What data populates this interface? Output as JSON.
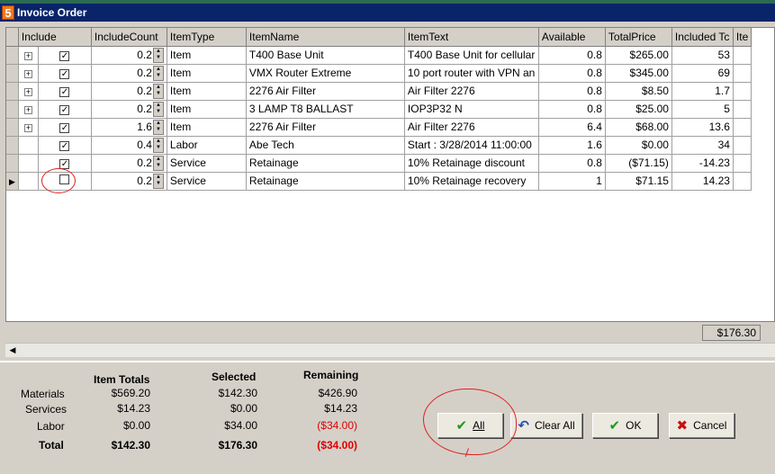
{
  "window": {
    "title": "Invoice Order",
    "app_icon_glyph": "5"
  },
  "grid": {
    "columns": [
      "Include",
      "IncludeCount",
      "ItemType",
      "ItemName",
      "ItemText",
      "Available",
      "TotalPrice",
      "Included Tc",
      "Ite"
    ],
    "rows": [
      {
        "expand": "+",
        "checked": "✓",
        "count": "0.2",
        "type": "Item",
        "name": "T400 Base Unit",
        "text": "T400 Base Unit for cellular",
        "available": "0.8",
        "total_price": "$265.00",
        "included": "53"
      },
      {
        "expand": "+",
        "checked": "✓",
        "count": "0.2",
        "type": "Item",
        "name": "VMX Router Extreme",
        "text": "10 port router with VPN an",
        "available": "0.8",
        "total_price": "$345.00",
        "included": "69"
      },
      {
        "expand": "+",
        "checked": "✓",
        "count": "0.2",
        "type": "Item",
        "name": "2276 Air Filter",
        "text": "Air Filter 2276",
        "available": "0.8",
        "total_price": "$8.50",
        "included": "1.7"
      },
      {
        "expand": "+",
        "checked": "✓",
        "count": "0.2",
        "type": "Item",
        "name": "3 LAMP T8 BALLAST",
        "text": "IOP3P32 N",
        "available": "0.8",
        "total_price": "$25.00",
        "included": "5"
      },
      {
        "expand": "+",
        "checked": "✓",
        "count": "1.6",
        "type": "Item",
        "name": "2276 Air Filter",
        "text": "Air Filter 2276",
        "available": "6.4",
        "total_price": "$68.00",
        "included": "13.6"
      },
      {
        "expand": "",
        "checked": "✓",
        "count": "0.4",
        "type": "Labor",
        "name": "Abe Tech",
        "text": "Start :  3/28/2014 11:00:00",
        "available": "1.6",
        "total_price": "$0.00",
        "included": "34"
      },
      {
        "expand": "",
        "checked": "✓",
        "count": "0.2",
        "type": "Service",
        "name": "Retainage",
        "text": "10% Retainage discount",
        "available": "0.8",
        "total_price": "($71.15)",
        "included": "-14.23"
      },
      {
        "expand": "",
        "checked": "",
        "count": "0.2",
        "type": "Service",
        "name": "Retainage",
        "text": "10% Retainage recovery",
        "available": "1",
        "total_price": "$71.15",
        "included": "14.23",
        "current": "▶"
      }
    ],
    "footer_total": "$176.30"
  },
  "summary": {
    "headers": {
      "item_totals": "Item Totals",
      "selected": "Selected",
      "remaining": "Remaining"
    },
    "rows": [
      {
        "label": "Materials",
        "item_totals": "$569.20",
        "selected": "$142.30",
        "remaining": "$426.90"
      },
      {
        "label": "Services",
        "item_totals": "$14.23",
        "selected": "$0.00",
        "remaining": "$14.23"
      },
      {
        "label": "Labor",
        "item_totals": "$0.00",
        "selected": "$34.00",
        "remaining": "($34.00)"
      },
      {
        "label": "Total",
        "item_totals": "$142.30",
        "selected": "$176.30",
        "remaining": "($34.00)"
      }
    ]
  },
  "buttons": {
    "all": "All",
    "clear_all": "Clear All",
    "ok": "OK",
    "cancel": "Cancel"
  },
  "icons": {
    "check": "✔",
    "undo": "↶",
    "cross": "✖",
    "scroll_left": "◀",
    "spin_up": "▲",
    "spin_down": "▼"
  },
  "colors": {
    "title_bar": "#0a246a",
    "negative": "#e00000",
    "annotation": "#e02020",
    "check_green": "#1a9a1a",
    "cancel_red": "#c81010"
  }
}
